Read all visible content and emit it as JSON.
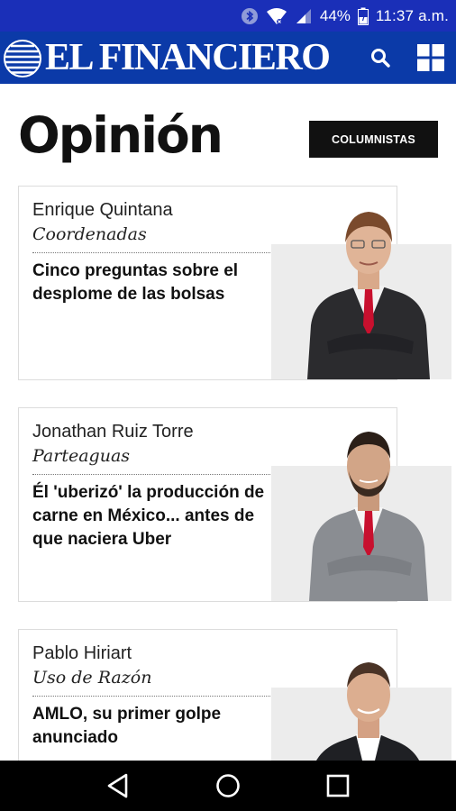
{
  "status_bar": {
    "icons": [
      "bluetooth-icon",
      "wifi-icon",
      "signal-icon",
      "battery-icon"
    ],
    "battery_percent": "44%",
    "time": "11:37 a.m."
  },
  "header": {
    "logo_text": "EL FINANCIERO",
    "actions": [
      "search-icon",
      "grid-menu-icon"
    ],
    "brand_color": "#0b3aa8"
  },
  "page": {
    "title": "Opinión",
    "columnistas_label": "COLUMNISTAS"
  },
  "articles": [
    {
      "author": "Enrique Quintana",
      "column": "Coordenadas",
      "headline": "Cinco preguntas sobre el desplome de las bolsas",
      "tie_color": "#c8102e",
      "suit_color": "#2b2b2e"
    },
    {
      "author": "Jonathan Ruiz Torre",
      "column": "Parteaguas",
      "headline": "Él 'uberizó' la producción de carne en México... antes de que naciera Uber",
      "tie_color": "#c8102e",
      "suit_color": "#8a8d92"
    },
    {
      "author": "Pablo Hiriart",
      "column": "Uso de Razón",
      "headline": "AMLO, su primer golpe anunciado",
      "tie_color": "",
      "suit_color": "#1f2024"
    }
  ],
  "nav_bar": {
    "buttons": [
      "back-icon",
      "home-icon",
      "recents-icon"
    ]
  }
}
